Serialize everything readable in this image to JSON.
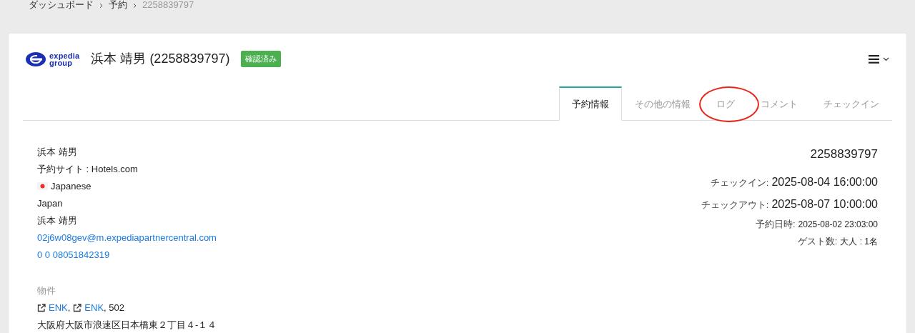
{
  "breadcrumb": [
    {
      "label": "ダッシュボード",
      "current": false
    },
    {
      "label": "予約",
      "current": false
    },
    {
      "label": "2258839797",
      "current": true
    }
  ],
  "header": {
    "logo": {
      "line1": "expedia",
      "line2": "group"
    },
    "title": "浜本 靖男 (2258839797)",
    "status": "確認済み"
  },
  "tabs": [
    {
      "label": "予約情報",
      "selected": true,
      "circled": false
    },
    {
      "label": "その他の情報",
      "selected": false,
      "circled": false
    },
    {
      "label": "ログ",
      "selected": false,
      "circled": true
    },
    {
      "label": "コメント",
      "selected": false,
      "circled": false
    },
    {
      "label": "チェックイン",
      "selected": false,
      "circled": false
    }
  ],
  "guest": [
    {
      "kind": "text",
      "text": "浜本 靖男"
    },
    {
      "kind": "text",
      "text": "予約サイト : Hotels.com"
    },
    {
      "kind": "language",
      "text": "Japanese"
    },
    {
      "kind": "text",
      "text": "Japan"
    },
    {
      "kind": "text",
      "text": "浜本 靖男"
    },
    {
      "kind": "link",
      "text": "02j6w08gev@m.expediapartnercentral.com"
    },
    {
      "kind": "link",
      "text": "0 0 08051842319"
    }
  ],
  "property": {
    "label": "物件",
    "links": [
      "ENK",
      "ENK"
    ],
    "separator": ",",
    "room": ", 502",
    "address": "大阪府大阪市浪速区日本橋東２丁目４-１４"
  },
  "summary": {
    "reservation_id": "2258839797",
    "rows": [
      {
        "kind": "large",
        "label": "チェックイン:",
        "value": "2025-08-04 16:00:00"
      },
      {
        "kind": "large",
        "label": "チェックアウト:",
        "value": "2025-08-07 10:00:00"
      },
      {
        "kind": "small",
        "label": "予約日時:",
        "value": "2025-08-02 23:03:00"
      },
      {
        "kind": "small",
        "label": "ゲスト数:",
        "value": "大人 : 1名"
      }
    ]
  }
}
